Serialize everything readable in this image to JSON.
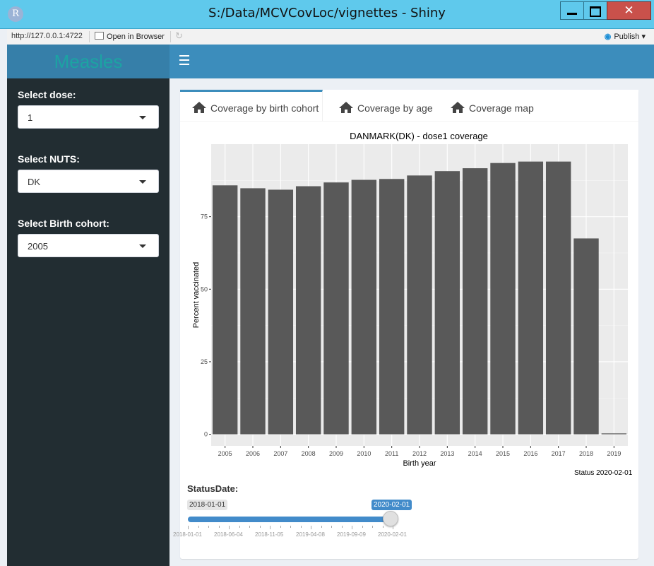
{
  "window": {
    "title": "S:/Data/MCVCovLoc/vignettes - Shiny",
    "icon_letter": "R"
  },
  "viewer": {
    "url": "http://127.0.0.1:4722",
    "open_browser": "Open in Browser",
    "publish": "Publish"
  },
  "header": {
    "logo": "Measles"
  },
  "sidebar": {
    "dose_label": "Select dose:",
    "dose_value": "1",
    "nuts_label": "Select NUTS:",
    "nuts_value": "DK",
    "cohort_label": "Select Birth cohort:",
    "cohort_value": "2005"
  },
  "tabs": [
    "Coverage by birth cohort",
    "Coverage by age",
    "Coverage map"
  ],
  "chart_data": {
    "type": "bar",
    "title": "DANMARK(DK) - dose1 coverage",
    "xlabel": "Birth year",
    "ylabel": "Percent vaccinated",
    "caption": "Status 2020-02-01",
    "categories": [
      "2005",
      "2006",
      "2007",
      "2008",
      "2009",
      "2010",
      "2011",
      "2012",
      "2013",
      "2014",
      "2015",
      "2016",
      "2017",
      "2018",
      "2019"
    ],
    "values": [
      85.8,
      84.8,
      84.3,
      85.5,
      86.8,
      87.7,
      88.0,
      89.2,
      90.7,
      91.7,
      93.5,
      94.0,
      94.0,
      67.5,
      0.3
    ],
    "yticks": [
      0,
      25,
      50,
      75
    ],
    "ylim": [
      -4,
      100
    ],
    "bar_color": "#595959",
    "panel_color": "#ebebeb"
  },
  "status_slider": {
    "label": "StatusDate:",
    "min": "2018-01-01",
    "value": "2020-02-01",
    "ticks": [
      "2018-01-01",
      "2018-06-04",
      "2018-11-05",
      "2019-04-08",
      "2019-09-09",
      "2020-02-01"
    ]
  }
}
